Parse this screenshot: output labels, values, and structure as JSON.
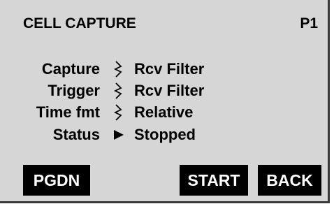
{
  "header": {
    "title": "CELL CAPTURE",
    "page": "P1"
  },
  "settings": [
    {
      "label": "Capture",
      "indicator": "select-lightning-icon",
      "value": "Rcv Filter"
    },
    {
      "label": "Trigger",
      "indicator": "select-lightning-icon",
      "value": "Rcv Filter"
    },
    {
      "label": "Time fmt",
      "indicator": "select-lightning-icon",
      "value": "Relative"
    },
    {
      "label": "Status",
      "indicator": "play-triangle-icon",
      "value": "Stopped"
    }
  ],
  "softkeys": {
    "pgdn": "PGDN",
    "start": "START",
    "back": "BACK"
  },
  "colors": {
    "screen_background": "#d6d6d6",
    "text": "#000000",
    "softkey_background": "#000000",
    "softkey_text": "#ffffff",
    "bezel": "#3a3a3a"
  }
}
